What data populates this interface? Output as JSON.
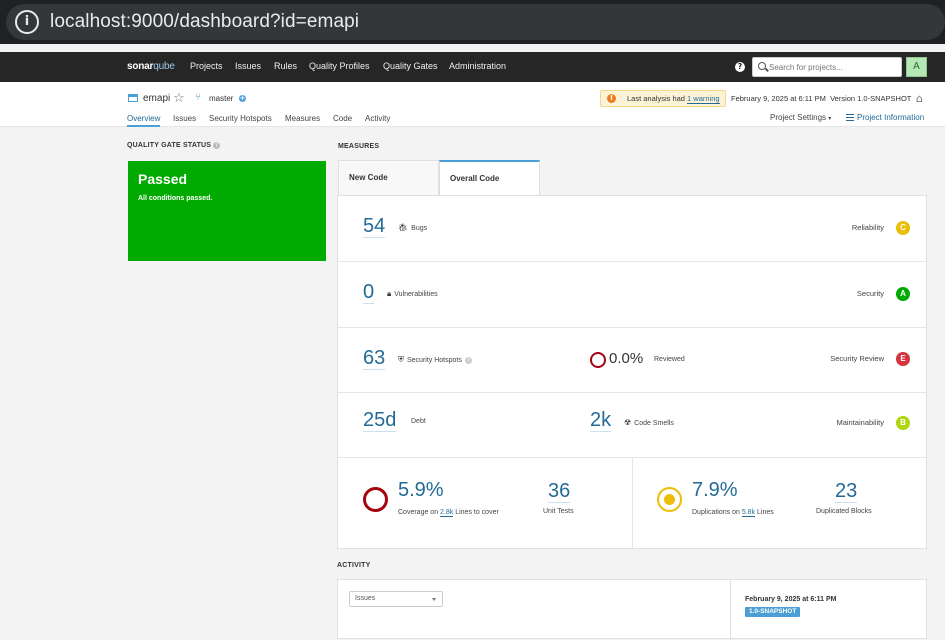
{
  "browser": {
    "url": "localhost:9000/dashboard?id=emapi"
  },
  "nav": {
    "logo_main": "sonar",
    "logo_accent": "qube",
    "items": [
      "Projects",
      "Issues",
      "Rules",
      "Quality Profiles",
      "Quality Gates",
      "Administration"
    ],
    "help": "?",
    "search_placeholder": "Search for projects...",
    "avatar": "A"
  },
  "project": {
    "name": "emapi",
    "branch": "master",
    "warning_prefix": "Last analysis had ",
    "warning_link": "1 warning",
    "analysis_info": "February 9, 2025 at 6:11 PM  Version 1.0-SNAPSHOT",
    "tabs": [
      "Overview",
      "Issues",
      "Security Hotspots",
      "Measures",
      "Code",
      "Activity"
    ],
    "settings": "Project Settings",
    "info": "Project Information"
  },
  "quality_gate": {
    "section_title": "QUALITY GATE STATUS",
    "status": "Passed",
    "message": "All conditions passed.",
    "status_color": "#00aa00"
  },
  "measures": {
    "section_title": "MEASURES",
    "tabs": [
      "New Code",
      "Overall Code"
    ],
    "bugs": {
      "value": "54",
      "label": "Bugs",
      "rating_label": "Reliability",
      "rating": "C",
      "rating_color": "#eabe06"
    },
    "vulnerabilities": {
      "value": "0",
      "label": "Vulnerabilities",
      "rating_label": "Security",
      "rating": "A",
      "rating_color": "#00aa00"
    },
    "hotspots": {
      "value": "63",
      "label": "Security Hotspots",
      "reviewed_value": "0.0%",
      "reviewed_label": "Reviewed",
      "rating_label": "Security Review",
      "rating": "E",
      "rating_color": "#d4333f"
    },
    "maintainability": {
      "debt_value": "25d",
      "debt_label": "Debt",
      "smells_value": "2k",
      "smells_label": "Code Smells",
      "rating_label": "Maintainability",
      "rating": "B",
      "rating_color": "#b0d513"
    },
    "coverage": {
      "value": "5.9%",
      "label_prefix": "Coverage on ",
      "lines_value": "2.8k",
      "label_suffix": " Lines to cover",
      "unit_tests_value": "36",
      "unit_tests_label": "Unit Tests"
    },
    "duplications": {
      "value": "7.9%",
      "label_prefix": "Duplications on ",
      "lines_value": "5.8k",
      "label_suffix": " Lines",
      "blocks_value": "23",
      "blocks_label": "Duplicated Blocks"
    }
  },
  "activity": {
    "section_title": "ACTIVITY",
    "select_value": "Issues",
    "date": "February 9, 2025 at 6:11 PM",
    "version_badge": "1.0-SNAPSHOT"
  }
}
